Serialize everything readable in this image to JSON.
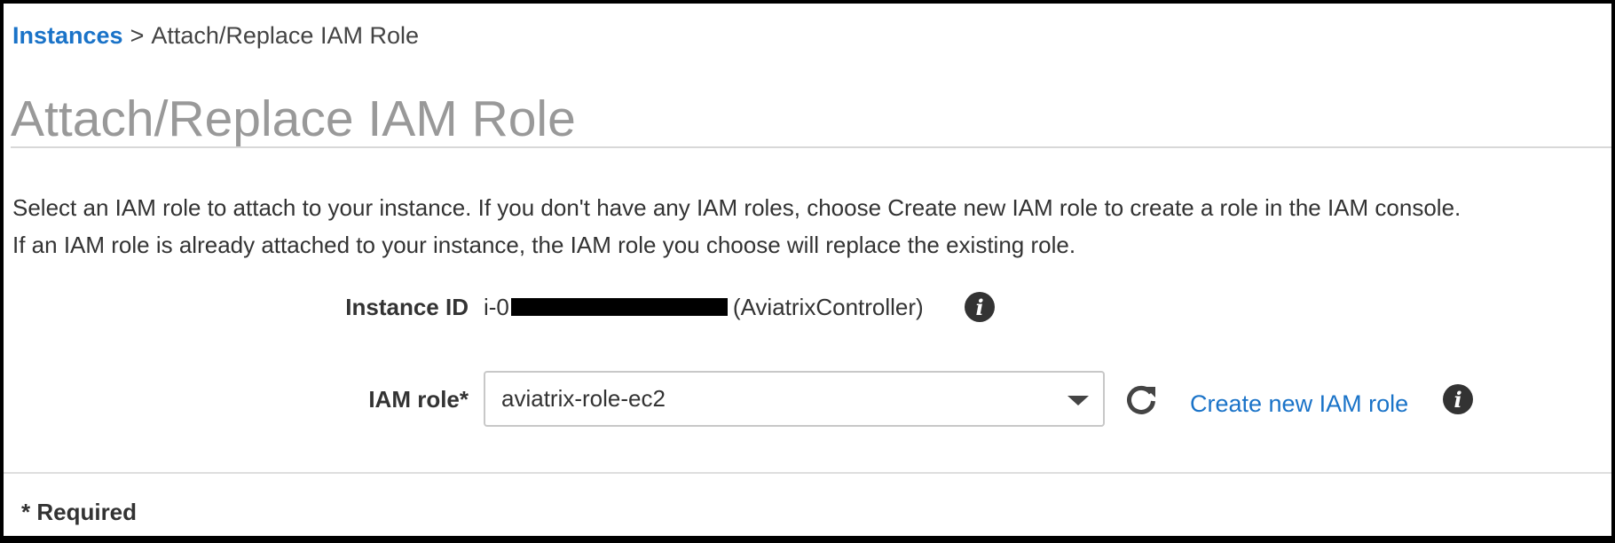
{
  "breadcrumb": {
    "parent": "Instances",
    "separator": ">",
    "current": "Attach/Replace IAM Role"
  },
  "page": {
    "title": "Attach/Replace IAM Role",
    "description_line1": "Select an IAM role to attach to your instance. If you don't have any IAM roles, choose Create new IAM role to create a role in the IAM console.",
    "description_line2": "If an IAM role is already attached to your instance, the IAM role you choose will replace the existing role."
  },
  "instance": {
    "label": "Instance ID",
    "id_prefix": "i-0",
    "name": "(AviatrixController)"
  },
  "iam_role": {
    "label": "IAM role*",
    "selected": "aviatrix-role-ec2",
    "create_link": "Create new IAM role"
  },
  "footer": {
    "required_note": "* Required"
  },
  "icons": {
    "info": "info-icon",
    "refresh": "refresh-icon",
    "dropdown": "chevron-down-icon"
  },
  "colors": {
    "link": "#1a73c8",
    "title": "#999999",
    "text": "#333333"
  }
}
